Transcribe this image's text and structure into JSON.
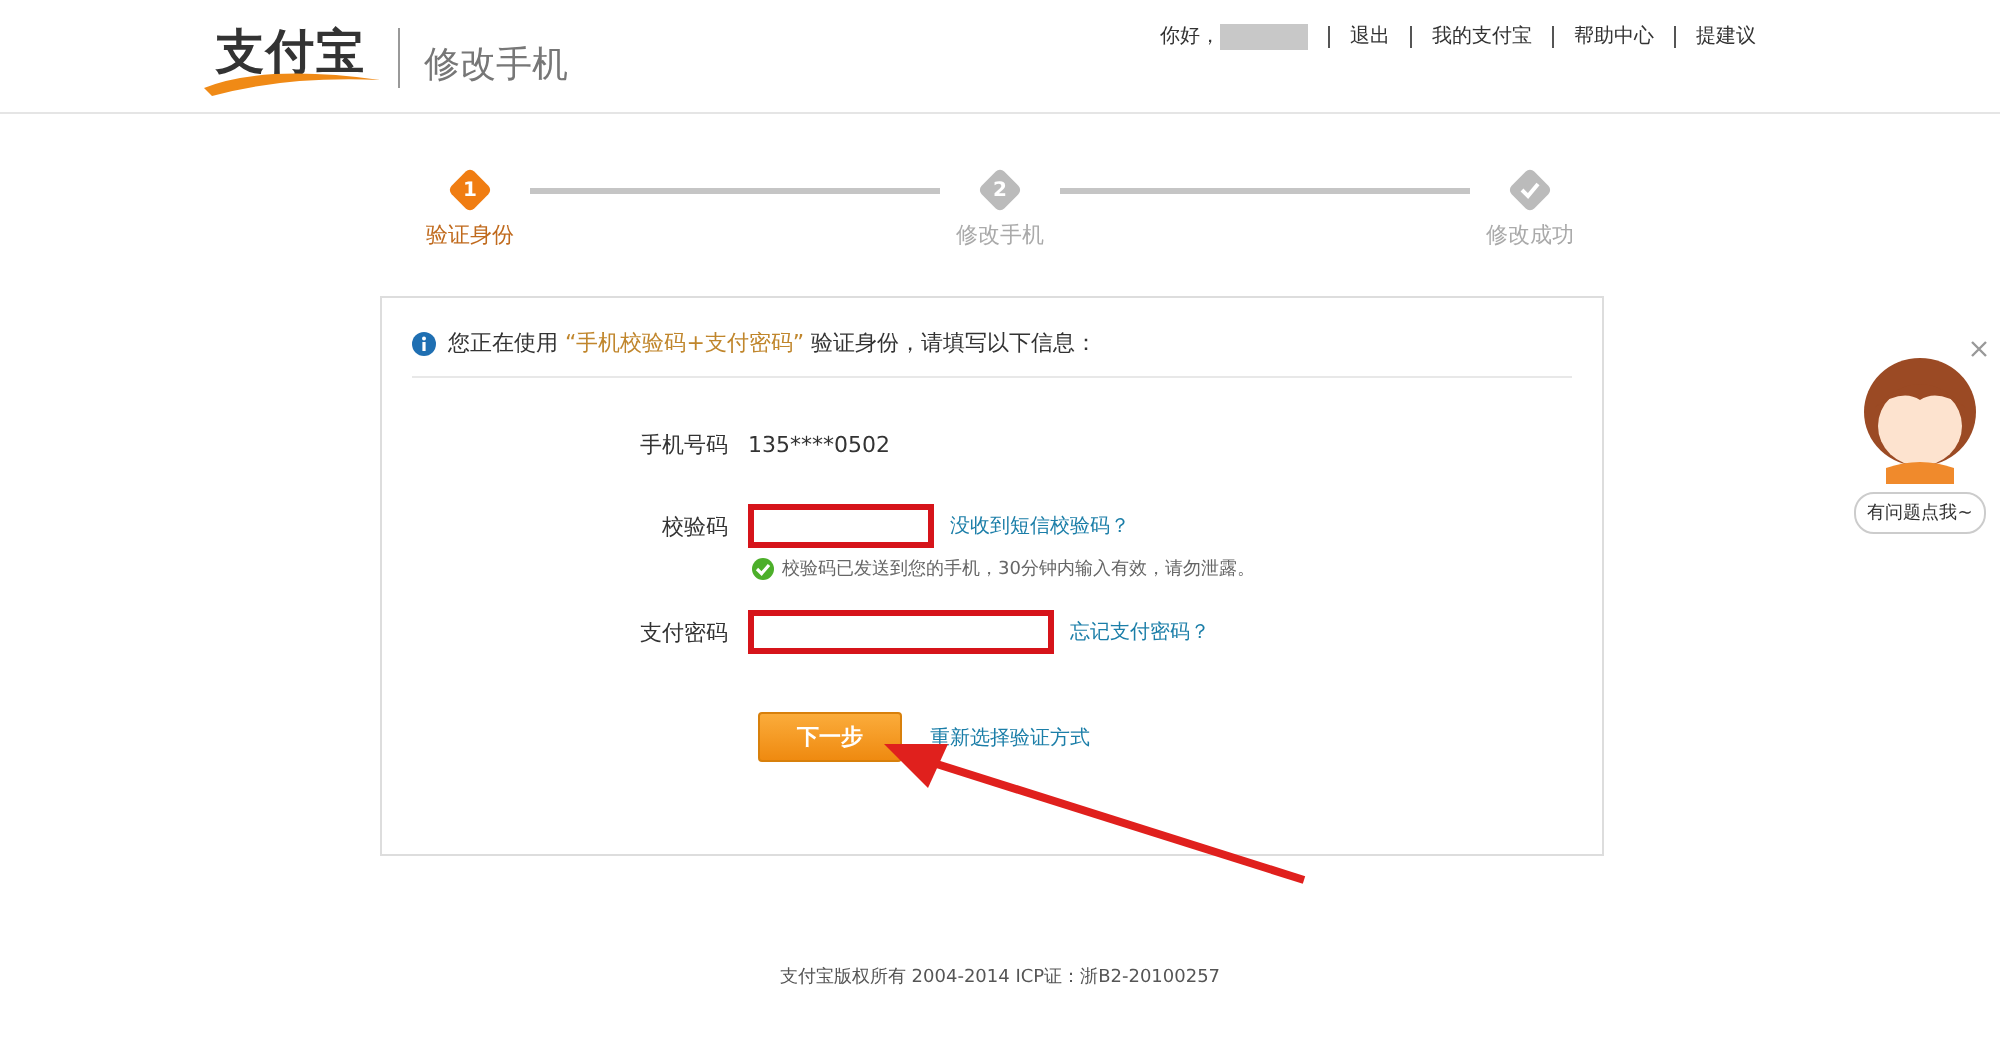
{
  "header": {
    "logo": "支付宝",
    "title": "修改手机",
    "greeting": "你好，",
    "links": [
      "退出",
      "我的支付宝",
      "帮助中心",
      "提建议"
    ]
  },
  "steps": [
    {
      "number": "1",
      "label": "验证身份",
      "selected": true,
      "kind": "number"
    },
    {
      "number": "2",
      "label": "修改手机",
      "selected": false,
      "kind": "number"
    },
    {
      "label": "修改成功",
      "selected": false,
      "kind": "check"
    }
  ],
  "notice": {
    "before": "您正在使用 ",
    "method": "“手机校验码+支付密码”",
    "after": " 验证身份，请填写以下信息："
  },
  "form": {
    "phone_label": "手机号码",
    "phone_value": "135****0502",
    "code_label": "校验码",
    "code_link": "没收到短信校验码？",
    "code_hint": "校验码已发送到您的手机，30分钟内输入有效，请勿泄露。",
    "password_label": "支付密码",
    "password_link": "忘记支付密码？",
    "submit": "下一步",
    "alt_link": "重新选择验证方式"
  },
  "footer": "支付宝版权所有 2004-2014 ICP证：浙B2-20100257",
  "assistant": {
    "bubble": "有问题点我~"
  }
}
